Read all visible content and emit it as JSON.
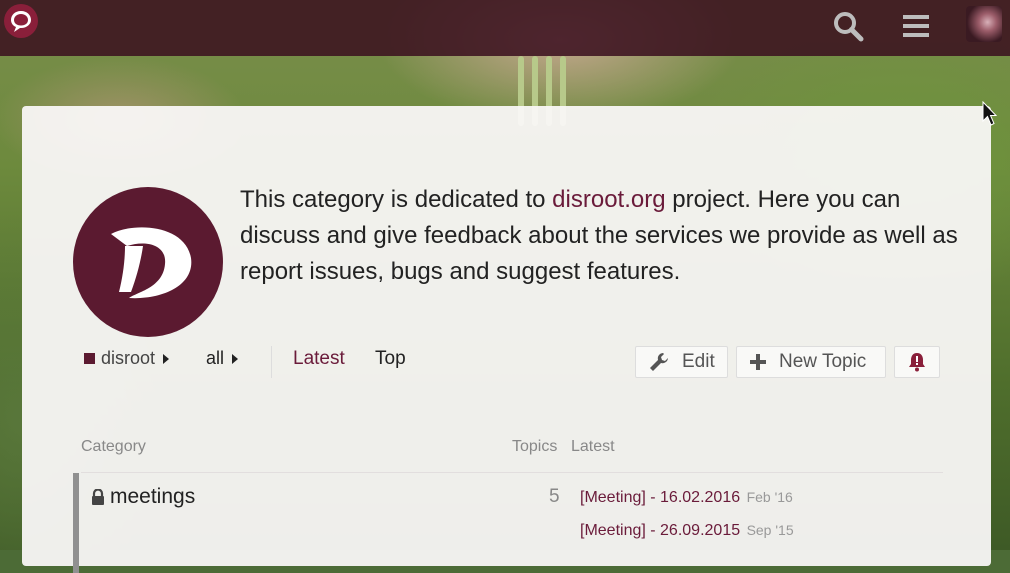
{
  "header": {
    "logo_icon": "disroot-chat-bubble-icon",
    "search_icon": "search-icon",
    "menu_icon": "hamburger-menu-icon",
    "avatar": "user-avatar"
  },
  "category": {
    "logo_icon": "disroot-d-logo",
    "description": {
      "before": "This category is dedicated to ",
      "link": "disroot.org",
      "after": " project. Here you can discuss and give feedback about the services we provide as well as report issues, bugs and suggest features."
    }
  },
  "nav": {
    "breadcrumb_category": "disroot",
    "breadcrumb_subcategory": "all",
    "latest": "Latest",
    "top": "Top",
    "edit_button": "Edit",
    "new_topic_button": "New Topic",
    "notifications_icon": "bell-warning-icon"
  },
  "table": {
    "headers": {
      "category": "Category",
      "topics": "Topics",
      "latest": "Latest"
    },
    "rows": [
      {
        "name": "meetings",
        "locked": true,
        "topics": "5",
        "latest": [
          {
            "title": "[Meeting] - 16.02.2016",
            "ago": "Feb '16"
          },
          {
            "title": "[Meeting] - 26.09.2015",
            "ago": "Sep '15"
          }
        ]
      }
    ]
  },
  "colors": {
    "brand": "#5b1a30",
    "header_bg": "#3a0f1e",
    "link": "#6a1b3a",
    "row_border": "#909090"
  }
}
